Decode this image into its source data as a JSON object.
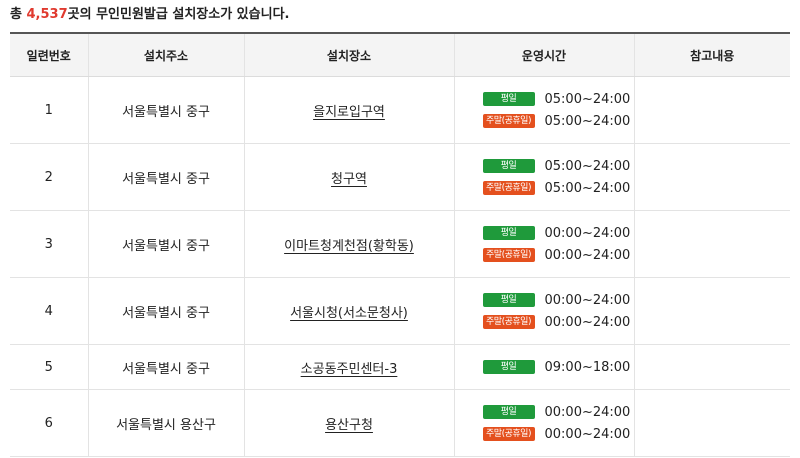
{
  "summary": {
    "prefix": "총 ",
    "count": "4,537",
    "suffix": "곳의 무인민원발급 설치장소가 있습니다."
  },
  "columns": {
    "no": "일련번호",
    "address": "설치주소",
    "place": "설치장소",
    "hours": "운영시간",
    "note": "참고내용"
  },
  "colors": {
    "accent": "#e03a2f",
    "weekday_badge": "#1f9a3b",
    "weekend_badge": "#e4501e"
  },
  "rows": [
    {
      "no": "1",
      "address": "서울특별시 중구",
      "place": "을지로입구역",
      "note": "",
      "hours": [
        {
          "badge": "평일",
          "time": "05:00~24:00"
        },
        {
          "badge": "주말(공휴일)",
          "time": "05:00~24:00"
        }
      ]
    },
    {
      "no": "2",
      "address": "서울특별시 중구",
      "place": "청구역",
      "note": "",
      "hours": [
        {
          "badge": "평일",
          "time": "05:00~24:00"
        },
        {
          "badge": "주말(공휴일)",
          "time": "05:00~24:00"
        }
      ]
    },
    {
      "no": "3",
      "address": "서울특별시 중구",
      "place": "이마트청계천점(황학동)",
      "note": "",
      "hours": [
        {
          "badge": "평일",
          "time": "00:00~24:00"
        },
        {
          "badge": "주말(공휴일)",
          "time": "00:00~24:00"
        }
      ]
    },
    {
      "no": "4",
      "address": "서울특별시 중구",
      "place": "서울시청(서소문청사)",
      "note": "",
      "hours": [
        {
          "badge": "평일",
          "time": "00:00~24:00"
        },
        {
          "badge": "주말(공휴일)",
          "time": "00:00~24:00"
        }
      ]
    },
    {
      "no": "5",
      "address": "서울특별시 중구",
      "place": "소공동주민센터-3",
      "note": "",
      "hours": [
        {
          "badge": "평일",
          "time": "09:00~18:00"
        }
      ]
    },
    {
      "no": "6",
      "address": "서울특별시 용산구",
      "place": "용산구청",
      "note": "",
      "hours": [
        {
          "badge": "평일",
          "time": "00:00~24:00"
        },
        {
          "badge": "주말(공휴일)",
          "time": "00:00~24:00"
        }
      ]
    }
  ]
}
